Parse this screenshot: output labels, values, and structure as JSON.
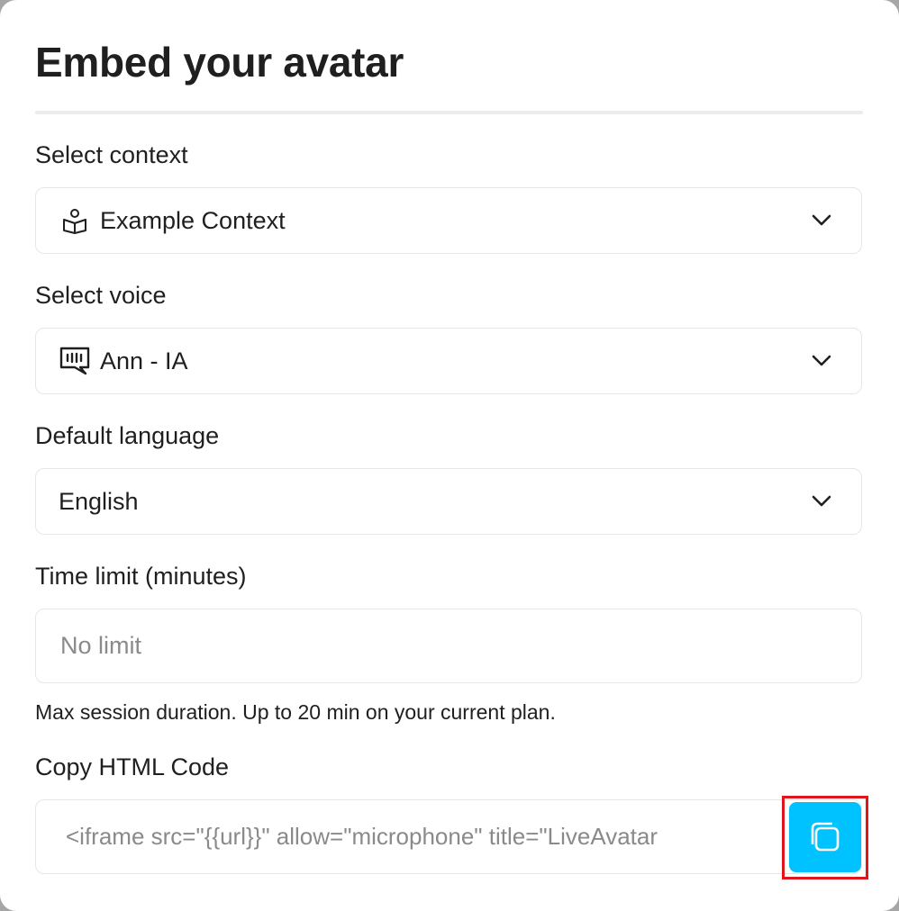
{
  "modal": {
    "title": "Embed your avatar"
  },
  "context": {
    "label": "Select context",
    "value": "Example Context",
    "icon": "book-reader-icon"
  },
  "voice": {
    "label": "Select voice",
    "value": "Ann - IA",
    "icon": "voice-message-icon"
  },
  "language": {
    "label": "Default language",
    "value": "English"
  },
  "time_limit": {
    "label": "Time limit (minutes)",
    "placeholder": "No limit",
    "hint": "Max session duration. Up to 20 min on your current plan."
  },
  "html_code": {
    "label": "Copy HTML Code",
    "value": "<iframe src=\"{{url}}\" allow=\"microphone\" title=\"LiveAvatar",
    "copy_icon": "copy-icon"
  },
  "colors": {
    "accent": "#00c2ff",
    "highlight": "#e0161d",
    "text": "#1f1f1f",
    "muted": "#8a8a8a",
    "border": "#e6e6e6"
  }
}
